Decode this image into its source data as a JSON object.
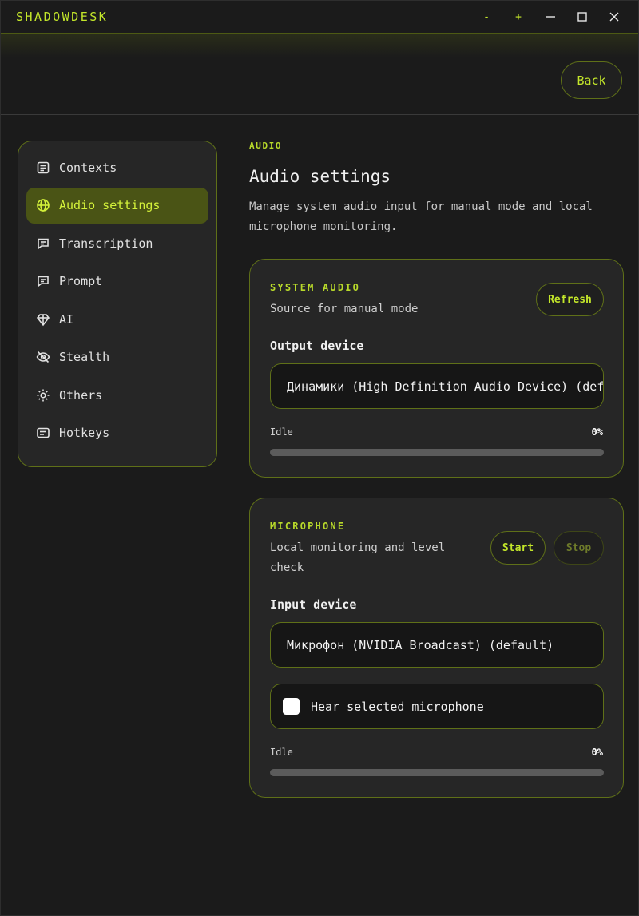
{
  "window": {
    "title": "SHADOWDESK",
    "controls": [
      "-",
      "+",
      "minimize",
      "maximize",
      "close"
    ]
  },
  "header": {
    "back_label": "Back"
  },
  "sidebar": {
    "items": [
      {
        "label": "Contexts",
        "icon": "document-icon",
        "active": false
      },
      {
        "label": "Audio settings",
        "icon": "globe-icon",
        "active": true
      },
      {
        "label": "Transcription",
        "icon": "chat-icon",
        "active": false
      },
      {
        "label": "Prompt",
        "icon": "chat-icon",
        "active": false
      },
      {
        "label": "AI",
        "icon": "diamond-icon",
        "active": false
      },
      {
        "label": "Stealth",
        "icon": "eye-off-icon",
        "active": false
      },
      {
        "label": "Others",
        "icon": "sun-icon",
        "active": false
      },
      {
        "label": "Hotkeys",
        "icon": "keyboard-icon",
        "active": false
      }
    ]
  },
  "main": {
    "eyebrow": "AUDIO",
    "title": "Audio settings",
    "description": "Manage system audio input for manual mode and local microphone monitoring."
  },
  "system_audio": {
    "label": "SYSTEM AUDIO",
    "subtitle": "Source for manual mode",
    "refresh_label": "Refresh",
    "field_label": "Output device",
    "selected_device": "Динамики (High Definition Audio Device) (default)",
    "status": "Idle",
    "level_text": "0%",
    "level_fraction": 0
  },
  "microphone": {
    "label": "MICROPHONE",
    "subtitle": "Local monitoring and level check",
    "start_label": "Start",
    "stop_label": "Stop",
    "field_label": "Input device",
    "selected_device": "Микрофон (NVIDIA Broadcast) (default)",
    "hear_label": "Hear selected microphone",
    "hear_checked": false,
    "status": "Idle",
    "level_text": "0%",
    "level_fraction": 0
  },
  "colors": {
    "accent": "#c3e62a",
    "border": "#5f7018",
    "active_bg": "#4a5415"
  }
}
